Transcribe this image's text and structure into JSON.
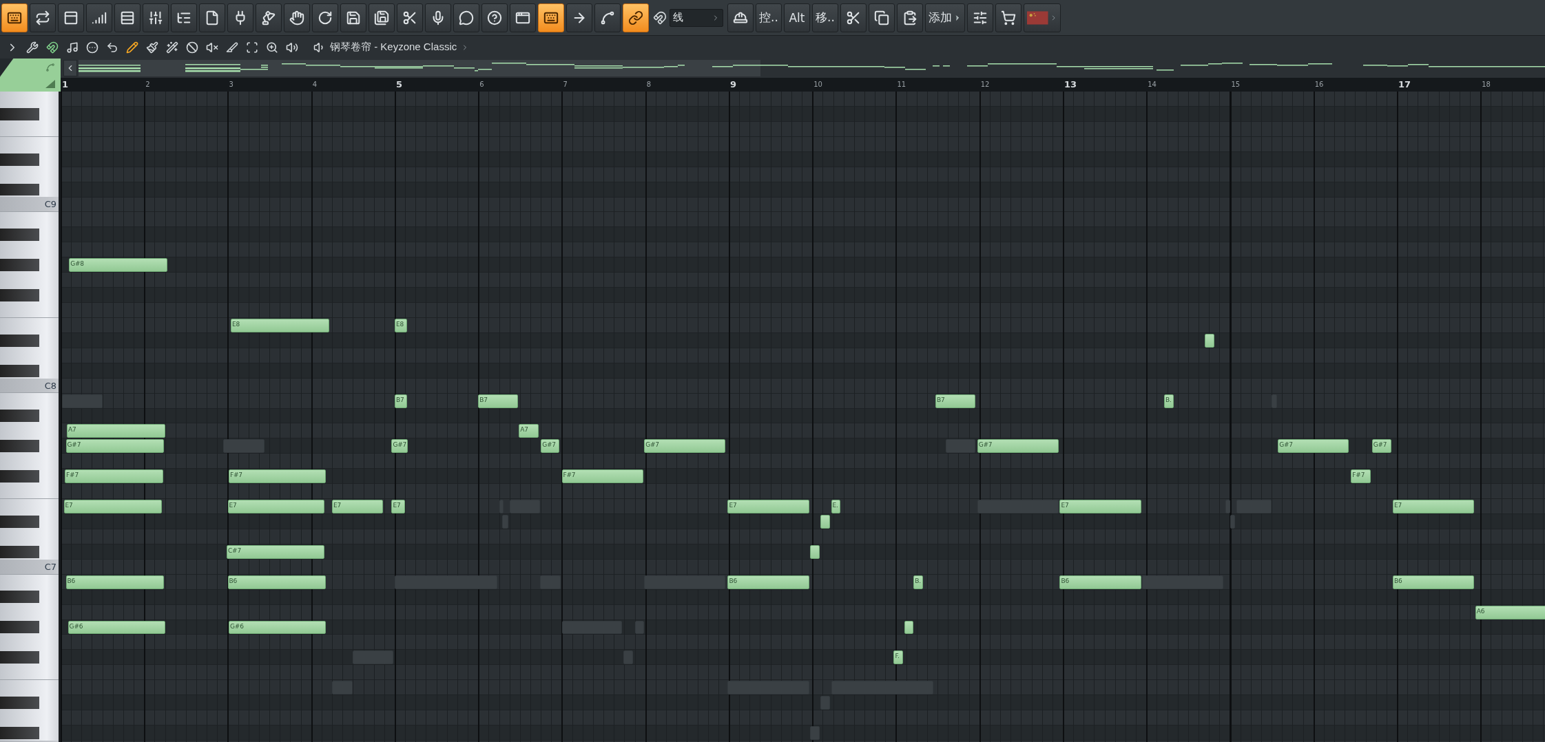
{
  "toolbar": [
    {
      "kind": "icon",
      "selected": true
    },
    {
      "kind": "icon",
      "selected": false
    },
    {
      "kind": "icon",
      "selected": false
    },
    {
      "kind": "icon",
      "selected": false
    },
    {
      "kind": "icon",
      "selected": false
    },
    {
      "kind": "icon",
      "selected": false
    },
    {
      "kind": "icon",
      "selected": false
    },
    {
      "kind": "icon",
      "selected": false
    },
    {
      "kind": "icon",
      "selected": false
    },
    {
      "kind": "icon",
      "selected": false
    },
    {
      "kind": "icon",
      "selected": false
    },
    {
      "kind": "icon",
      "selected": false
    },
    {
      "kind": "icon",
      "selected": false
    },
    {
      "kind": "icon",
      "selected": false
    },
    {
      "kind": "icon",
      "selected": false
    },
    {
      "kind": "icon",
      "selected": false
    },
    {
      "kind": "icon",
      "selected": false
    },
    {
      "kind": "icon",
      "selected": false
    },
    {
      "kind": "icon",
      "selected": false
    },
    {
      "kind": "icon",
      "selected": true
    },
    {
      "kind": "icon",
      "selected": false
    },
    {
      "kind": "icon",
      "selected": false
    },
    {
      "kind": "icon",
      "selected": true
    },
    {
      "kind": "dropdown",
      "label": "线"
    },
    {
      "kind": "icon",
      "selected": false
    },
    {
      "kind": "text",
      "label": "控..",
      "selected": false
    },
    {
      "kind": "text",
      "label": "Alt",
      "selected": false
    },
    {
      "kind": "text",
      "label": "移..",
      "selected": false
    },
    {
      "kind": "icon",
      "selected": false
    },
    {
      "kind": "icon",
      "selected": false
    },
    {
      "kind": "icon",
      "selected": false
    },
    {
      "kind": "menu",
      "label": "添加"
    },
    {
      "kind": "icon",
      "selected": false
    },
    {
      "kind": "icon",
      "selected": false
    },
    {
      "kind": "flag"
    }
  ],
  "tools": [
    {
      "selected": false
    },
    {
      "selected": false
    },
    {
      "selected": true,
      "color": "#7fd08a"
    },
    {
      "selected": false
    },
    {
      "selected": false
    },
    {
      "selected": false
    },
    {
      "selected": true,
      "color": "#f5a623"
    },
    {
      "selected": false
    },
    {
      "selected": false
    },
    {
      "selected": false
    },
    {
      "selected": false
    },
    {
      "selected": false
    },
    {
      "selected": false
    },
    {
      "selected": false
    },
    {
      "selected": false
    }
  ],
  "title": {
    "label": "钢琴卷帘 - Keyzone Classic"
  },
  "ruler": [
    {
      "text": "1",
      "major": true
    },
    {
      "text": "2",
      "major": false
    },
    {
      "text": "3",
      "major": false
    },
    {
      "text": "4",
      "major": false
    },
    {
      "text": "5",
      "major": true
    },
    {
      "text": "6",
      "major": false
    },
    {
      "text": "7",
      "major": false
    },
    {
      "text": "8",
      "major": false
    },
    {
      "text": "9",
      "major": true
    },
    {
      "text": "10",
      "major": false
    },
    {
      "text": "11",
      "major": false
    },
    {
      "text": "12",
      "major": false
    },
    {
      "text": "13",
      "major": true
    },
    {
      "text": "14",
      "major": false
    },
    {
      "text": "15",
      "major": false
    },
    {
      "text": "16",
      "major": false
    },
    {
      "text": "17",
      "major": true
    },
    {
      "text": "18",
      "major": false
    }
  ],
  "octave_labels": [
    "C9",
    "C8",
    "C7"
  ],
  "notes": [
    {
      "kind": "note",
      "label": "G#8"
    },
    {
      "kind": "note",
      "label": "E8"
    },
    {
      "kind": "note",
      "label": "E8"
    },
    {
      "kind": "note"
    },
    {
      "kind": "ghost"
    },
    {
      "kind": "note",
      "label": "B7"
    },
    {
      "kind": "note",
      "label": "B7"
    },
    {
      "kind": "note",
      "label": "B7"
    },
    {
      "kind": "note",
      "label": "B."
    },
    {
      "kind": "ghost"
    },
    {
      "kind": "note",
      "label": "A7"
    },
    {
      "kind": "note",
      "label": "A7"
    },
    {
      "kind": "note",
      "label": "G#7"
    },
    {
      "kind": "ghost"
    },
    {
      "kind": "note",
      "label": "G#7"
    },
    {
      "kind": "note",
      "label": "G#7"
    },
    {
      "kind": "note",
      "label": "G#7"
    },
    {
      "kind": "ghost"
    },
    {
      "kind": "note",
      "label": "G#7"
    },
    {
      "kind": "note",
      "label": "G#7"
    },
    {
      "kind": "note",
      "label": "G#7"
    },
    {
      "kind": "note",
      "label": "F#7"
    },
    {
      "kind": "note",
      "label": "F#7"
    },
    {
      "kind": "note",
      "label": "F#7"
    },
    {
      "kind": "note",
      "label": "F#7"
    },
    {
      "kind": "note",
      "label": "E7"
    },
    {
      "kind": "note",
      "label": "E7"
    },
    {
      "kind": "note",
      "label": "E7"
    },
    {
      "kind": "note",
      "label": "E7"
    },
    {
      "kind": "ghost"
    },
    {
      "kind": "ghost"
    },
    {
      "kind": "note",
      "label": "E7"
    },
    {
      "kind": "note",
      "label": "E."
    },
    {
      "kind": "ghost"
    },
    {
      "kind": "note",
      "label": "E7"
    },
    {
      "kind": "ghost"
    },
    {
      "kind": "ghost"
    },
    {
      "kind": "note",
      "label": "E7"
    },
    {
      "kind": "ghost"
    },
    {
      "kind": "note"
    },
    {
      "kind": "ghost"
    },
    {
      "kind": "note",
      "label": "C#7"
    },
    {
      "kind": "note"
    },
    {
      "kind": "note",
      "label": "B6"
    },
    {
      "kind": "note",
      "label": "B6"
    },
    {
      "kind": "ghost"
    },
    {
      "kind": "ghost"
    },
    {
      "kind": "ghost"
    },
    {
      "kind": "note",
      "label": "B6"
    },
    {
      "kind": "note",
      "label": "B."
    },
    {
      "kind": "note",
      "label": "B6"
    },
    {
      "kind": "ghost"
    },
    {
      "kind": "note",
      "label": "B6"
    },
    {
      "kind": "note",
      "label": "A6"
    },
    {
      "kind": "note",
      "label": "G#6"
    },
    {
      "kind": "note",
      "label": "G#6"
    },
    {
      "kind": "ghost"
    },
    {
      "kind": "ghost"
    },
    {
      "kind": "note"
    },
    {
      "kind": "ghost"
    },
    {
      "kind": "ghost"
    },
    {
      "kind": "note",
      "label": "F."
    },
    {
      "kind": "ghost"
    },
    {
      "kind": "ghost"
    },
    {
      "kind": "ghost"
    },
    {
      "kind": "ghost"
    },
    {
      "kind": "ghost"
    }
  ]
}
